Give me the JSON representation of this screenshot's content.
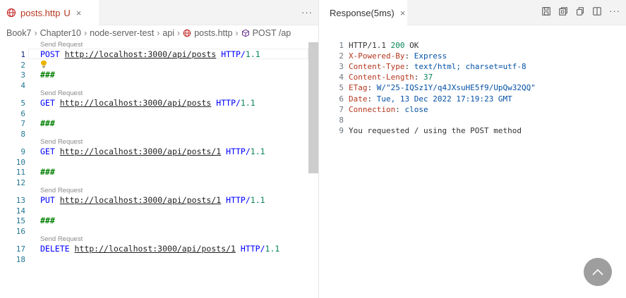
{
  "left_pane": {
    "tab": {
      "file_name": "posts.http",
      "badge": "U",
      "close": "×"
    },
    "more": "···",
    "breadcrumb": [
      "Book7",
      "Chapter10",
      "node-server-test",
      "api",
      "posts.http",
      "POST /ap"
    ],
    "send_request_label": "Send Request",
    "lines": [
      {
        "num": "1",
        "kind": "req",
        "method": "POST",
        "url": "http://localhost:3000/api/posts",
        "send": true,
        "active": true
      },
      {
        "num": "2",
        "kind": "bulb"
      },
      {
        "num": "3",
        "kind": "sep",
        "text": "###"
      },
      {
        "num": "4",
        "kind": "blank"
      },
      {
        "num": "5",
        "kind": "req",
        "method": "GET",
        "url": "http://localhost:3000/api/posts",
        "send": true
      },
      {
        "num": "6",
        "kind": "blank"
      },
      {
        "num": "7",
        "kind": "sep",
        "text": "###"
      },
      {
        "num": "8",
        "kind": "blank"
      },
      {
        "num": "9",
        "kind": "req",
        "method": "GET",
        "url": "http://localhost:3000/api/posts/1",
        "send": true
      },
      {
        "num": "10",
        "kind": "blank"
      },
      {
        "num": "11",
        "kind": "sep",
        "text": "###"
      },
      {
        "num": "12",
        "kind": "blank"
      },
      {
        "num": "13",
        "kind": "req",
        "method": "PUT",
        "url": "http://localhost:3000/api/posts/1",
        "send": true
      },
      {
        "num": "14",
        "kind": "blank"
      },
      {
        "num": "15",
        "kind": "sep",
        "text": "###"
      },
      {
        "num": "16",
        "kind": "blank"
      },
      {
        "num": "17",
        "kind": "req",
        "method": "DELETE",
        "url": "http://localhost:3000/api/posts/1",
        "send": true
      },
      {
        "num": "18",
        "kind": "blank"
      }
    ],
    "http_version_prefix": "HTTP/",
    "http_version_number": "1.1"
  },
  "right_pane": {
    "tab": {
      "title": "Response(5ms)",
      "close": "×"
    },
    "more": "···",
    "lines": [
      {
        "num": "1",
        "parts": [
          {
            "t": "HTTP/1.1 ",
            "c": ""
          },
          {
            "t": "200",
            "c": "st"
          },
          {
            "t": " OK",
            "c": ""
          }
        ]
      },
      {
        "num": "2",
        "parts": [
          {
            "t": "X-Powered-By",
            "c": "hk"
          },
          {
            "t": ": ",
            "c": ""
          },
          {
            "t": "Express",
            "c": "hv"
          }
        ]
      },
      {
        "num": "3",
        "parts": [
          {
            "t": "Content-Type",
            "c": "hk"
          },
          {
            "t": ": ",
            "c": ""
          },
          {
            "t": "text/html; charset=utf-8",
            "c": "hv"
          }
        ]
      },
      {
        "num": "4",
        "parts": [
          {
            "t": "Content-Length",
            "c": "hk"
          },
          {
            "t": ": ",
            "c": ""
          },
          {
            "t": "37",
            "c": "st"
          }
        ]
      },
      {
        "num": "5",
        "parts": [
          {
            "t": "ETag",
            "c": "hk"
          },
          {
            "t": ": ",
            "c": ""
          },
          {
            "t": "W/\"25-IQSz1Y/q4JXsuHE5f9/UpQw32QQ\"",
            "c": "hv"
          }
        ]
      },
      {
        "num": "6",
        "parts": [
          {
            "t": "Date",
            "c": "hk"
          },
          {
            "t": ": ",
            "c": ""
          },
          {
            "t": "Tue, 13 Dec 2022 17:19:23 GMT",
            "c": "hv"
          }
        ]
      },
      {
        "num": "7",
        "parts": [
          {
            "t": "Connection",
            "c": "hk"
          },
          {
            "t": ": ",
            "c": ""
          },
          {
            "t": "close",
            "c": "hv"
          }
        ]
      },
      {
        "num": "8",
        "parts": []
      },
      {
        "num": "9",
        "parts": [
          {
            "t": "You requested / using the POST method",
            "c": ""
          }
        ]
      }
    ]
  },
  "colors": {
    "accent": "#0b216f",
    "method": "#0000ff",
    "separator": "#008000",
    "header_key": "#b5371f",
    "header_value": "#0451a5",
    "number": "#098658"
  },
  "icons": [
    "globe-icon",
    "close-icon",
    "more-actions-icon",
    "lightbulb-icon",
    "response-badge-icon",
    "save-icon",
    "open-in-editor-icon",
    "copy-icon",
    "split-editor-icon",
    "scroll-top-button"
  ]
}
